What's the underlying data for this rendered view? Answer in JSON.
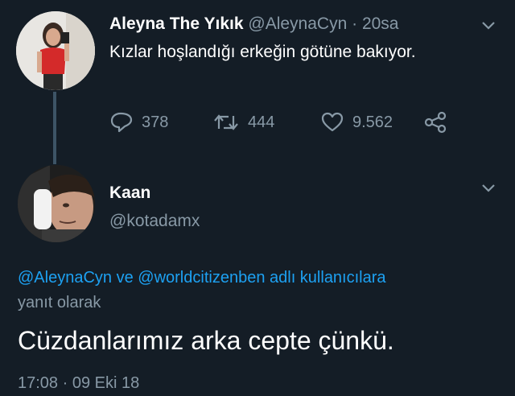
{
  "tweet1": {
    "name": "Aleyna The Yıkık",
    "handle": "@AleynaCyn",
    "separator": "·",
    "time": "20sa",
    "text": "Kızlar hoşlandığı erkeğin götüne bakıyor.",
    "avatar_icon": "user-photo",
    "actions": {
      "replies": "378",
      "retweets": "444",
      "likes": "9.562"
    }
  },
  "tweet2": {
    "name": "Kaan",
    "handle": "@kotadamx",
    "avatar_icon": "user-photo",
    "reply_to": {
      "user1": "@AleynaCyn",
      "connector": "ve",
      "user2": "@worldcitizenben",
      "suffix": "adlı kullanıcılara",
      "line2": "yanıt olarak"
    },
    "text": "Cüzdanlarımız arka cepte çünkü.",
    "timestamp": "17:08 · 09 Eki 18"
  },
  "colors": {
    "background": "#141d26",
    "secondary_text": "#8899a6",
    "link": "#1da1f2",
    "thread_line": "#3d5466"
  }
}
